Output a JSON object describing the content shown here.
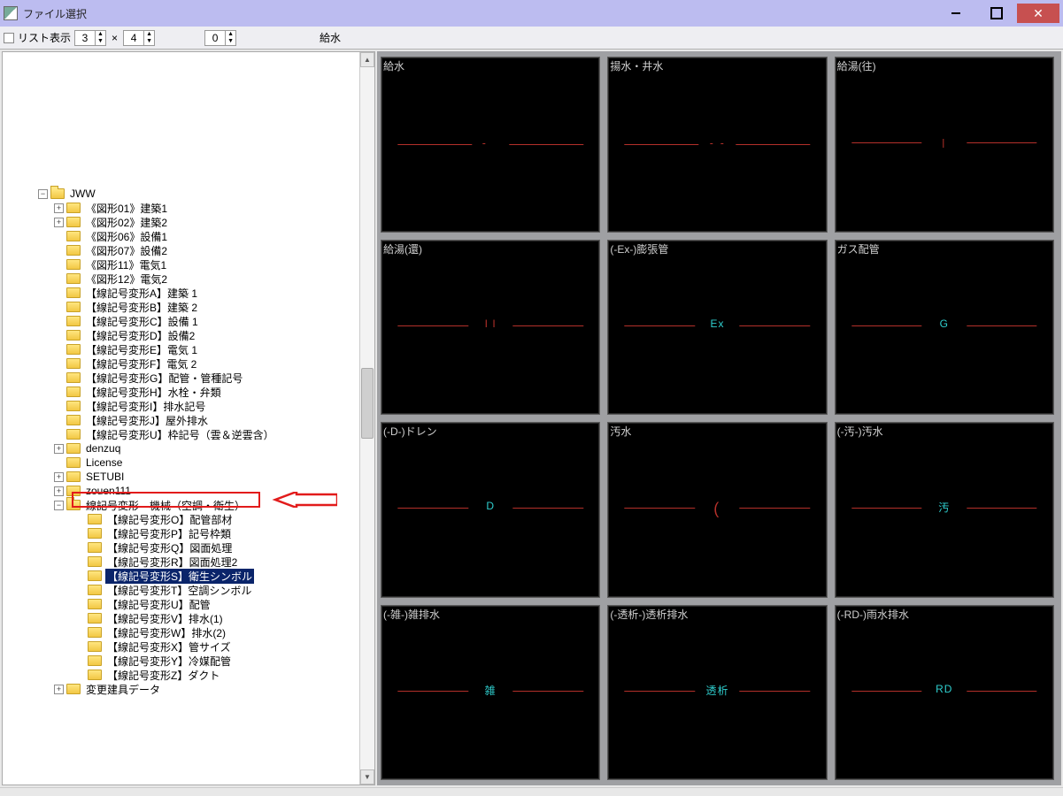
{
  "window": {
    "title": "ファイル選択"
  },
  "toolbar": {
    "list_checkbox_label": "リスト表示",
    "cols": "3",
    "rows": "4",
    "zero": "0",
    "preview_label": "給水"
  },
  "tree": {
    "root": "JWW",
    "items_level2": [
      "《図形01》建築1",
      "《図形02》建築2",
      "《図形06》設備1",
      "《図形07》設備2",
      "《図形11》電気1",
      "《図形12》電気2",
      "【線記号変形A】建築 1",
      "【線記号変形B】建築 2",
      "【線記号変形C】設備 1",
      "【線記号変形D】設備2",
      "【線記号変形E】電気 1",
      "【線記号変形F】電気 2",
      "【線記号変形G】配管・管種記号",
      "【線記号変形H】水栓・弁類",
      "【線記号変形I】排水記号",
      "【線記号変形J】屋外排水",
      "【線記号変形U】枠記号（雲＆逆雲含）",
      "denzuq",
      "License",
      "SETUBI",
      "zouen111"
    ],
    "group_folder": "線記号変形　機械（空調・衛生）",
    "items_level3": [
      "【線記号変形O】配管部材",
      "【線記号変形P】記号枠類",
      "【線記号変形Q】図面処理",
      "【線記号変形R】図面処理2",
      "【線記号変形S】衛生シンボル",
      "【線記号変形T】空調シンボル",
      "【線記号変形U】配管",
      "【線記号変形V】排水(1)",
      "【線記号変形W】排水(2)",
      "【線記号変形X】管サイズ",
      "【線記号変形Y】冷媒配管",
      "【線記号変形Z】ダクト"
    ],
    "selected_index_level3": 4,
    "last_folder": "変更建具データ"
  },
  "preview": {
    "cells": [
      {
        "title": "給水",
        "kind": "dash-dot-1"
      },
      {
        "title": "揚水・井水",
        "kind": "dash-dot-2"
      },
      {
        "title": "給湯(往)",
        "kind": "line-hair-i"
      },
      {
        "title": "給湯(還)",
        "kind": "text",
        "text": "I I",
        "color": "red"
      },
      {
        "title": "(-Ex-)膨張管",
        "kind": "text",
        "text": "Ex",
        "color": "cyan"
      },
      {
        "title": "ガス配管",
        "kind": "text",
        "text": "G",
        "color": "cyan"
      },
      {
        "title": "(-D-)ドレン",
        "kind": "text",
        "text": "D",
        "color": "cyan"
      },
      {
        "title": "汚水",
        "kind": "paren-c"
      },
      {
        "title": "(-汚-)汚水",
        "kind": "text",
        "text": "汚",
        "color": "cyan"
      },
      {
        "title": "(-雑-)雑排水",
        "kind": "text",
        "text": "雑",
        "color": "cyan"
      },
      {
        "title": "(-透析-)透析排水",
        "kind": "text",
        "text": "透析",
        "color": "cyan"
      },
      {
        "title": "(-RD-)雨水排水",
        "kind": "text",
        "text": "RD",
        "color": "cyan"
      }
    ]
  }
}
